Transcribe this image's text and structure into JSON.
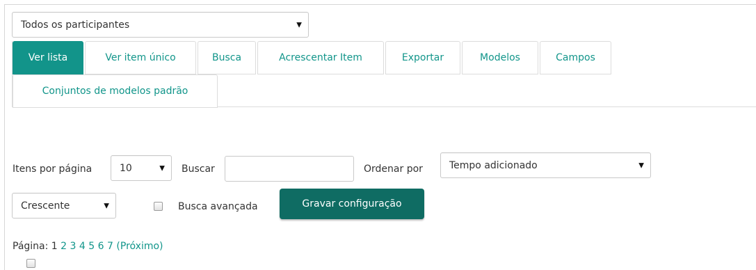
{
  "group_select": {
    "value": "Todos os participantes"
  },
  "tabs": [
    {
      "label": "Ver lista",
      "active": true
    },
    {
      "label": "Ver item único",
      "active": false
    },
    {
      "label": "Busca",
      "active": false
    },
    {
      "label": "Acrescentar Item",
      "active": false
    },
    {
      "label": "Exportar",
      "active": false
    },
    {
      "label": "Modelos",
      "active": false
    },
    {
      "label": "Campos",
      "active": false
    },
    {
      "label": "Conjuntos de modelos padrão",
      "active": false
    }
  ],
  "controls": {
    "per_page_label": "Itens por página",
    "per_page_value": "10",
    "search_label": "Buscar",
    "search_value": "",
    "sort_label": "Ordenar por",
    "sort_value": "Tempo adicionado",
    "order_value": "Crescente",
    "advanced_label": "Busca avançada",
    "save_button": "Gravar configuração"
  },
  "pagination": {
    "label": "Página:",
    "current": "1",
    "pages": [
      "2",
      "3",
      "4",
      "5",
      "6",
      "7"
    ],
    "next": "(Próximo)"
  },
  "colors": {
    "accent": "#12948a",
    "button": "#0f6c63"
  }
}
